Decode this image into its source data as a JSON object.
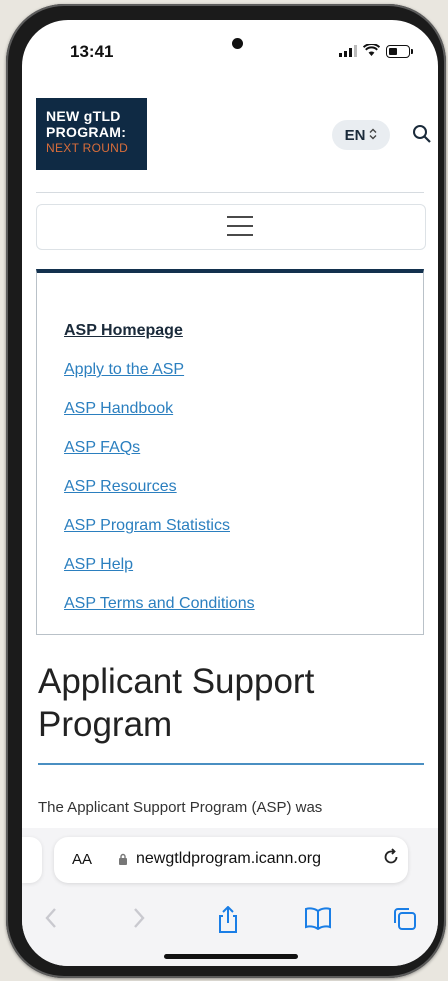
{
  "status_bar": {
    "time": "13:41"
  },
  "header": {
    "logo": {
      "line1": "NEW gTLD",
      "line2": "PROGRAM:",
      "line3": "NEXT ROUND"
    },
    "language": "EN"
  },
  "nav": {
    "items": [
      {
        "label": "ASP Homepage",
        "current": true
      },
      {
        "label": "Apply to the ASP"
      },
      {
        "label": "ASP Handbook"
      },
      {
        "label": "ASP FAQs"
      },
      {
        "label": "ASP Resources"
      },
      {
        "label": "ASP Program Statistics"
      },
      {
        "label": "ASP Help"
      },
      {
        "label": "ASP Terms and Conditions"
      }
    ]
  },
  "main": {
    "title_line1": "Applicant Support",
    "title_line2": "Program",
    "intro": "The Applicant Support Program (ASP) was"
  },
  "browser": {
    "text_size_button": "AA",
    "url": "newgtldprogram.icann.org"
  },
  "colors": {
    "brand_navy": "#0f2a44",
    "accent_orange": "#d96d3a",
    "link_blue": "#2b7fbf",
    "safari_blue": "#1a7ee6"
  },
  "icons": [
    "camera-icon",
    "signal-icon",
    "wifi-icon",
    "battery-icon",
    "chevron-updown-icon",
    "search-icon",
    "hamburger-icon",
    "lock-icon",
    "reload-icon",
    "back-icon",
    "forward-icon",
    "share-icon",
    "bookmarks-icon",
    "tabs-icon"
  ]
}
